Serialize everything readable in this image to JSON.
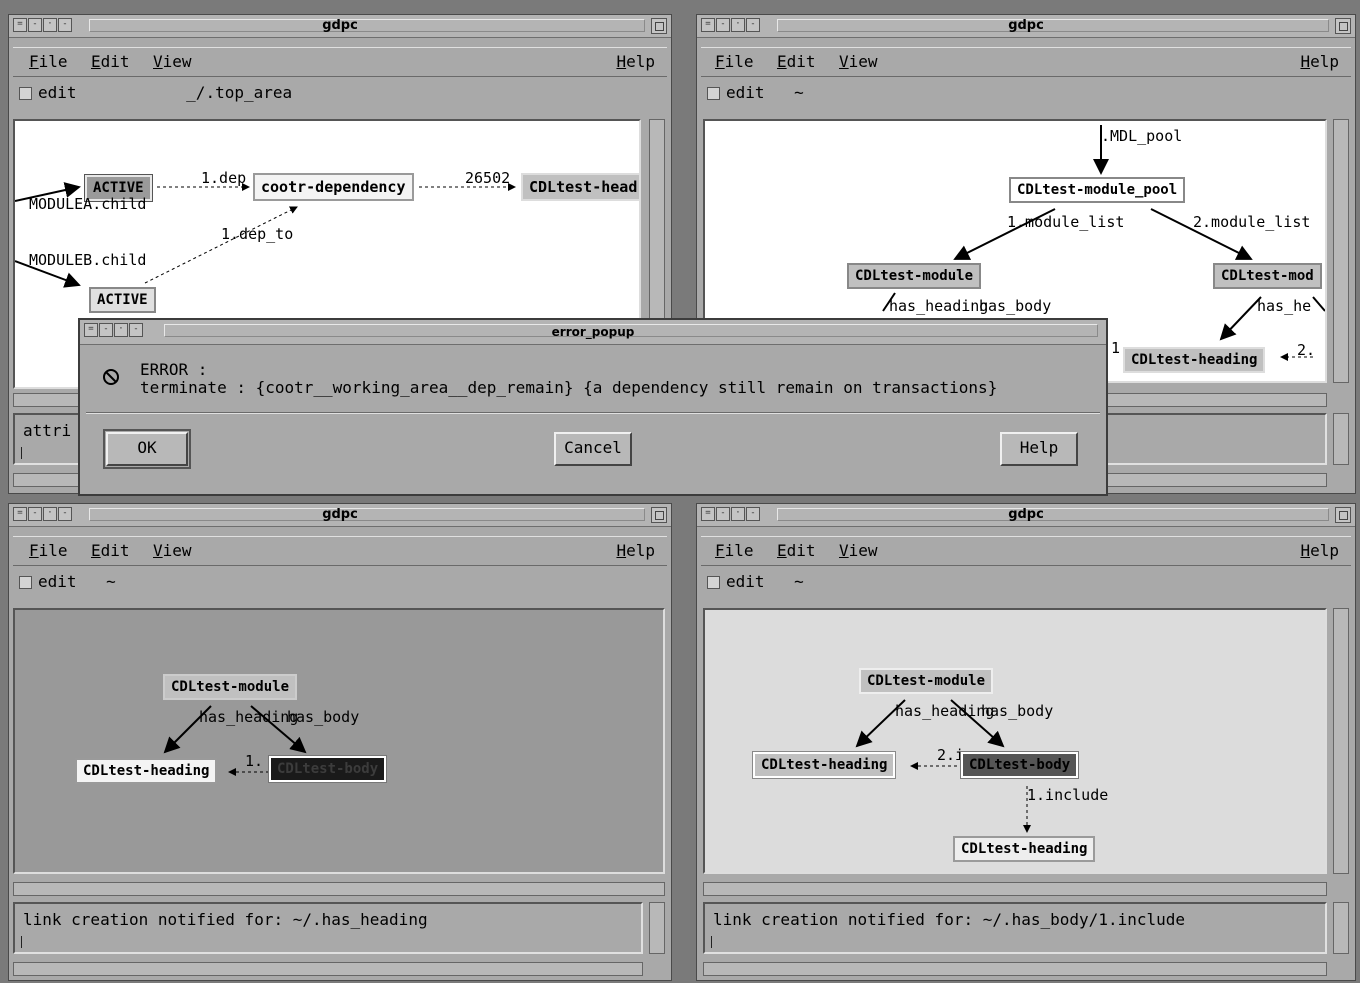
{
  "windows": [
    {
      "title": "gdpc",
      "menu": [
        "File",
        "Edit",
        "View",
        "Help"
      ],
      "edit_label": "edit",
      "path": "_/.top_area",
      "message": "attri"
    },
    {
      "title": "gdpc",
      "menu": [
        "File",
        "Edit",
        "View",
        "Help"
      ],
      "edit_label": "edit",
      "path": "~",
      "message": ""
    },
    {
      "title": "gdpc",
      "menu": [
        "File",
        "Edit",
        "View",
        "Help"
      ],
      "edit_label": "edit",
      "path": "~",
      "message": "link creation notified for: ~/.has_heading"
    },
    {
      "title": "gdpc",
      "menu": [
        "File",
        "Edit",
        "View",
        "Help"
      ],
      "edit_label": "edit",
      "path": "~",
      "message": "link creation notified for: ~/.has_body/1.include"
    }
  ],
  "graph1": {
    "nodes": {
      "active1": "ACTIVE",
      "active2": "ACTIVE",
      "dep": "cootr-dependency",
      "head": "CDLtest-head"
    },
    "labels": {
      "l1": "1.dep",
      "l2": "26502",
      "l3": "1.dep_to",
      "l4": "MODULEA.child",
      "l5": "MODULEB.child"
    }
  },
  "graph2": {
    "nodes": {
      "pool": "CDLtest-module_pool",
      "mod1": "CDLtest-module",
      "mod2": "CDLtest-mod",
      "heading": "CDLtest-heading"
    },
    "labels": {
      "l1": ".MDL_pool",
      "l2": "1.module_list",
      "l3": "2.module_list",
      "l4": "has_heading",
      "l5": "has_body",
      "l6": "has_he",
      "l7": "1",
      "l8": "2."
    }
  },
  "graph3": {
    "nodes": {
      "module": "CDLtest-module",
      "heading": "CDLtest-heading",
      "body": "CDLtest-body"
    },
    "labels": {
      "l1": "has_heading",
      "l2": "has_body",
      "l3": "1."
    }
  },
  "graph4": {
    "nodes": {
      "module": "CDLtest-module",
      "heading": "CDLtest-heading",
      "body": "CDLtest-body",
      "heading2": "CDLtest-heading"
    },
    "labels": {
      "l1": "has_heading",
      "l2": "has_body",
      "l3": "2.i",
      "l4": "1.include"
    }
  },
  "dialog": {
    "title": "error_popup",
    "heading": "ERROR :",
    "message": "terminate : {cootr__working_area__dep_remain} {a dependency still remain on transactions}",
    "ok": "OK",
    "cancel": "Cancel",
    "help": "Help"
  }
}
